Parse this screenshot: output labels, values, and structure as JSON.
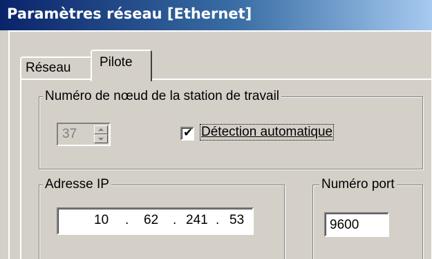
{
  "window": {
    "title": "Paramètres réseau [Ethernet]",
    "title_color": "#ffffff",
    "titlebar_color": "#0a246a"
  },
  "tabs": [
    {
      "label": "Réseau",
      "active": false
    },
    {
      "label": "Pilote",
      "active": true
    }
  ],
  "node_group": {
    "title": "Numéro de nœud de la station de travail",
    "spinner_value": "37",
    "spinner_enabled": false,
    "auto_detect_label": "Détection automatique",
    "auto_detect_checked": true
  },
  "ip_group": {
    "title": "Adresse IP",
    "octets": [
      "10",
      "62",
      "241",
      "53"
    ],
    "separator": "."
  },
  "port_group": {
    "title": "Numéro port",
    "value": "9600"
  },
  "icons": {
    "check": "check-icon",
    "spin_up": "arrow-up-icon",
    "spin_down": "arrow-down-icon"
  }
}
